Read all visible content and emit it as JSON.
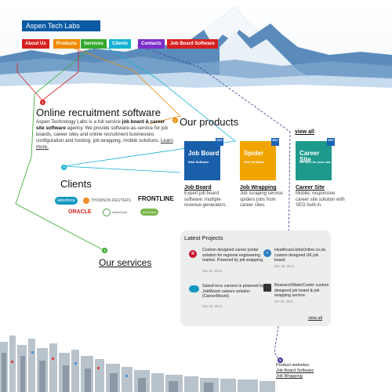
{
  "header": {
    "logo_text": "Aspen Tech Labs",
    "nav": [
      {
        "label": "About Us",
        "color": "#d62020"
      },
      {
        "label": "Products",
        "color": "#ef8a00"
      },
      {
        "label": "Services",
        "color": "#35a82e"
      },
      {
        "label": "Clients",
        "color": "#16b2d3"
      },
      {
        "label": "Contacts",
        "color": "#7b2cc9"
      },
      {
        "label": "Job Board Software",
        "color": "#d62020"
      }
    ]
  },
  "intro": {
    "heading": "Online recruitment software",
    "text_1": "Aspen Technology Labs is a full service ",
    "text_bold": "job board & career site software",
    "text_2": " agency. We provide software-as-service for job boards, career sites and online recruitment businesses: configuration and hosting, job wrapping, mobile solutions.",
    "learn_more": "Learn more."
  },
  "products": {
    "heading": "Our products",
    "view_all": "view all",
    "items": [
      {
        "box_title": "Job Board",
        "box_sub": "Web Software",
        "title": "Job Board",
        "desc": "Expert job board software: multiple revenue-generators.",
        "color": "#1a5fa9"
      },
      {
        "box_title": "Spider",
        "box_sub": "Web Software",
        "title": "Job Wrapping",
        "desc": "Job scraping service spiders jobs from career sites.",
        "color": "#f0a400"
      },
      {
        "box_title": "Career Site",
        "box_sub": "HR SEO for your site",
        "title": "Career Site",
        "desc": "Mobile, responsive career site solution with SEO built-in.",
        "color": "#1e9a8d"
      }
    ],
    "badge": "SEO"
  },
  "clients": {
    "heading": "Clients",
    "logos": [
      "salesforce",
      "THOMSON REUTERS",
      "FRONTLINE",
      "ORACLE",
      "eDataGuard",
      "bConnect"
    ]
  },
  "services": {
    "heading": "Our services"
  },
  "latest_projects": {
    "heading": "Latest Projects",
    "items": [
      {
        "text": "Custom designed career portal solution for regional engineering market. Powered by job wrapping.",
        "date": "Sep 04, 2015"
      },
      {
        "text": "HealthcareJobsOnline.co.uk, custom designed UK job board.",
        "date": "Dec 26, 2014"
      },
      {
        "text": "SalesForce careers is powered by JobMount careers solution (CareerMount).",
        "date": "Nov 15, 2014"
      },
      {
        "text": "ResearchWaterCooler custom designed job board & job wrapping service.",
        "date": "Oct 06, 2014"
      }
    ],
    "view_all": "view all"
  },
  "product_websites": {
    "label": "Product websites:",
    "links": [
      "Job Board Software",
      "Job Wrapping"
    ]
  },
  "markers": [
    "1",
    "2",
    "3",
    "4",
    "5"
  ]
}
